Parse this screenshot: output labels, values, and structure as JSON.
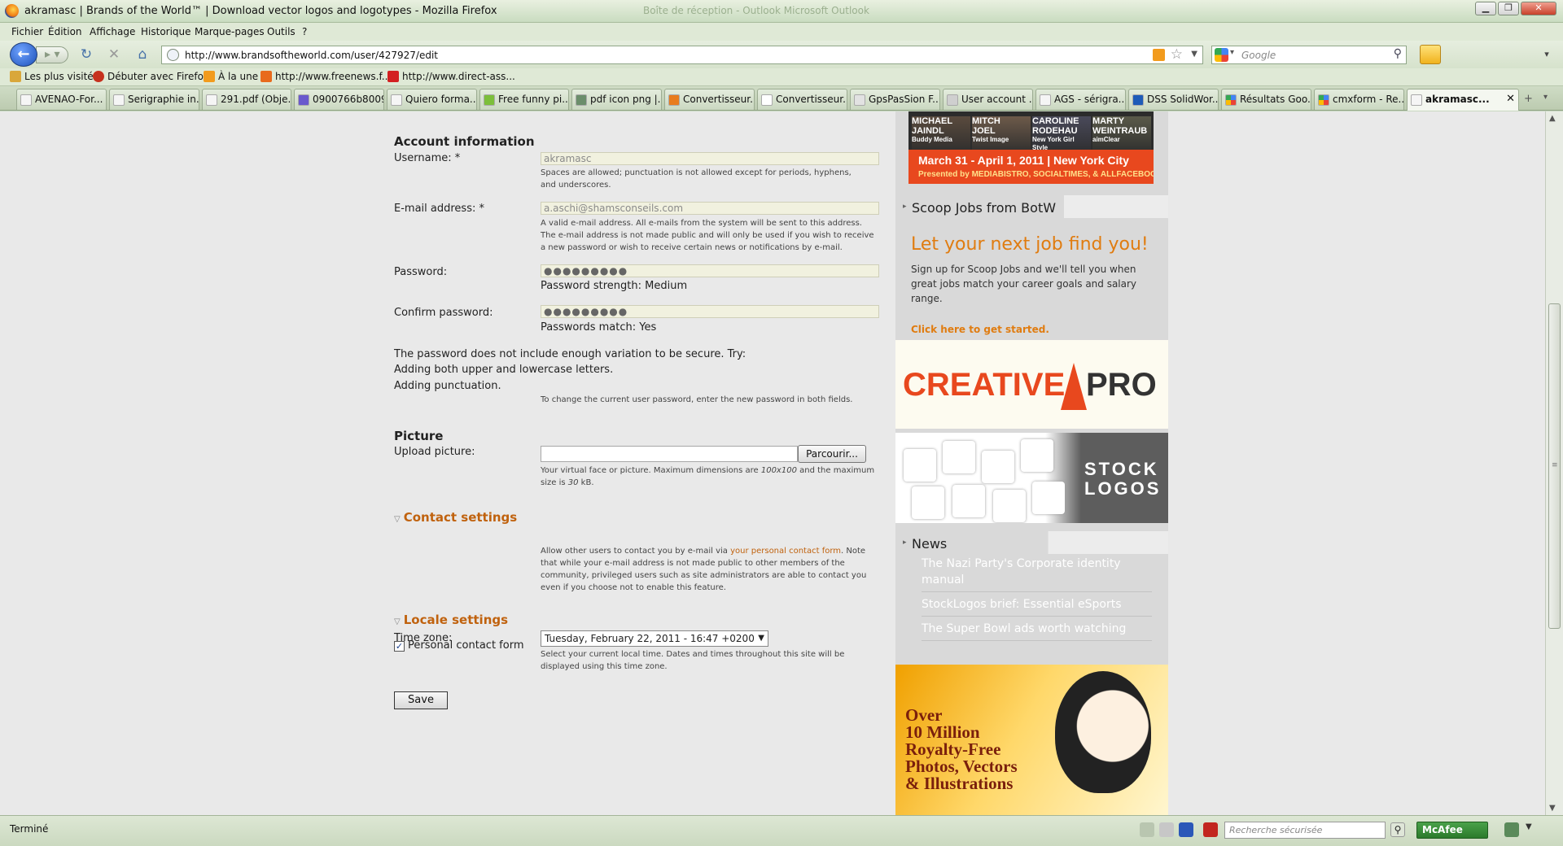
{
  "window": {
    "title": "akramasc | Brands of the World™ | Download vector logos and logotypes - Mozilla Firefox",
    "ghost_text": "Boîte de réception - Outlook    Microsoft Outlook"
  },
  "menu": [
    "Fichier",
    "Édition",
    "Affichage",
    "Historique",
    "Marque-pages",
    "Outils",
    "?"
  ],
  "url": "http://www.brandsoftheworld.com/user/427927/edit",
  "search": {
    "placeholder": "Google"
  },
  "bookmarks": [
    "Les plus visités",
    "Débuter avec Firefox",
    "À la une",
    "http://www.freenews.f...",
    "http://www.direct-ass..."
  ],
  "tabs": [
    "AVENAO-For...",
    "Serigraphie in...",
    "291.pdf (Obje...",
    "0900766b8009...",
    "Quiero forma...",
    "Free funny pi...",
    "pdf icon png |...",
    "Convertisseur...",
    "Convertisseur...",
    "GpsPasSion F...",
    "User account ...",
    "AGS - sérigra...",
    "DSS SolidWor...",
    "Résultats Goo...",
    "cmxform - Re...",
    "akramasc..."
  ],
  "form": {
    "account_title": "Account information",
    "username_label": "Username: *",
    "username_value": "akramasc",
    "username_desc": "Spaces are allowed; punctuation is not allowed except for periods, hyphens, and underscores.",
    "email_label": "E-mail address: *",
    "email_value": "a.aschi@shamsconseils.com",
    "email_desc": "A valid e-mail address. All e-mails from the system will be sent to this address. The e-mail address is not made public and will only be used if you wish to receive a new password or wish to receive certain news or notifications by e-mail.",
    "password_label": "Password:",
    "password_value": "●●●●●●●●●",
    "password_strength": "Password strength: Medium",
    "confirm_label": "Confirm password:",
    "confirm_value": "●●●●●●●●●",
    "passwords_match": "Passwords match: Yes",
    "variation_line1": "The password does not include enough variation to be secure. Try:",
    "variation_line2": "Adding both upper and lowercase letters.",
    "variation_line3": "Adding punctuation.",
    "change_desc": "To change the current user password, enter the new password in both fields.",
    "picture_title": "Picture",
    "upload_label": "Upload picture:",
    "browse_label": "Parcourir...",
    "picture_desc_a": "Your virtual face or picture. Maximum dimensions are ",
    "picture_dims": "100x100",
    "picture_desc_b": " and the maximum size is ",
    "picture_size": "30",
    "picture_desc_c": " kB.",
    "contact_title": "Contact settings",
    "contact_checkbox_label": "Personal contact form",
    "contact_checked": true,
    "contact_desc_a": "Allow other users to contact you by e-mail via ",
    "contact_link": "your personal contact form",
    "contact_desc_b": ". Note that while your e-mail address is not made public to other members of the community, privileged users such as site administrators are able to contact you even if you choose not to enable this feature.",
    "locale_title": "Locale settings",
    "timezone_label": "Time zone:",
    "timezone_value": "Tuesday, February 22, 2011 - 16:47 +0200",
    "timezone_desc": "Select your current local time. Dates and times throughout this site will be displayed using this time zone.",
    "save_label": "Save"
  },
  "sidebar": {
    "ad_top": {
      "speakers": [
        {
          "name1": "MICHAEL",
          "name2": "JAINDL",
          "org": "Buddy Media"
        },
        {
          "name1": "MITCH",
          "name2": "JOEL",
          "org": "Twist Image"
        },
        {
          "name1": "CAROLINE",
          "name2": "RODEHAU",
          "org": "New York Girl Style"
        },
        {
          "name1": "MARTY",
          "name2": "WEINTRAUB",
          "org": "aimClear"
        }
      ],
      "date_line": "March 31 - April 1, 2011 | New York City",
      "presented": "Presented by MEDIABISTRO, SOCIALTIMES, & ALLFACEBOOK"
    },
    "jobs_head": "Scoop Jobs from BotW",
    "jobs_title": "Let your next job find you!",
    "jobs_text": "Sign up for Scoop Jobs and we'll tell you when great jobs match your career goals and salary range.",
    "jobs_link": "Click here to get started.",
    "creativepro_a": "CREATIVE",
    "creativepro_b": "PRO",
    "stocklogos_a": "STOCK",
    "stocklogos_b": "LOGOS",
    "news_head": "News",
    "news": [
      "The Nazi Party's Corporate identity manual",
      "StockLogos brief: Essential eSports",
      "The Super Bowl ads worth watching"
    ],
    "photos_ad": [
      "Over",
      "10 Million",
      "Royalty-Free",
      "Photos, Vectors",
      "& Illustrations"
    ]
  },
  "status": {
    "text": "Terminé",
    "secure_search_placeholder": "Recherche sécurisée",
    "mcafee_label": "McAfee"
  },
  "colors": {
    "accent_orange": "#c0620e",
    "jobs_orange": "#e07c10",
    "creative_red": "#e8481e"
  }
}
